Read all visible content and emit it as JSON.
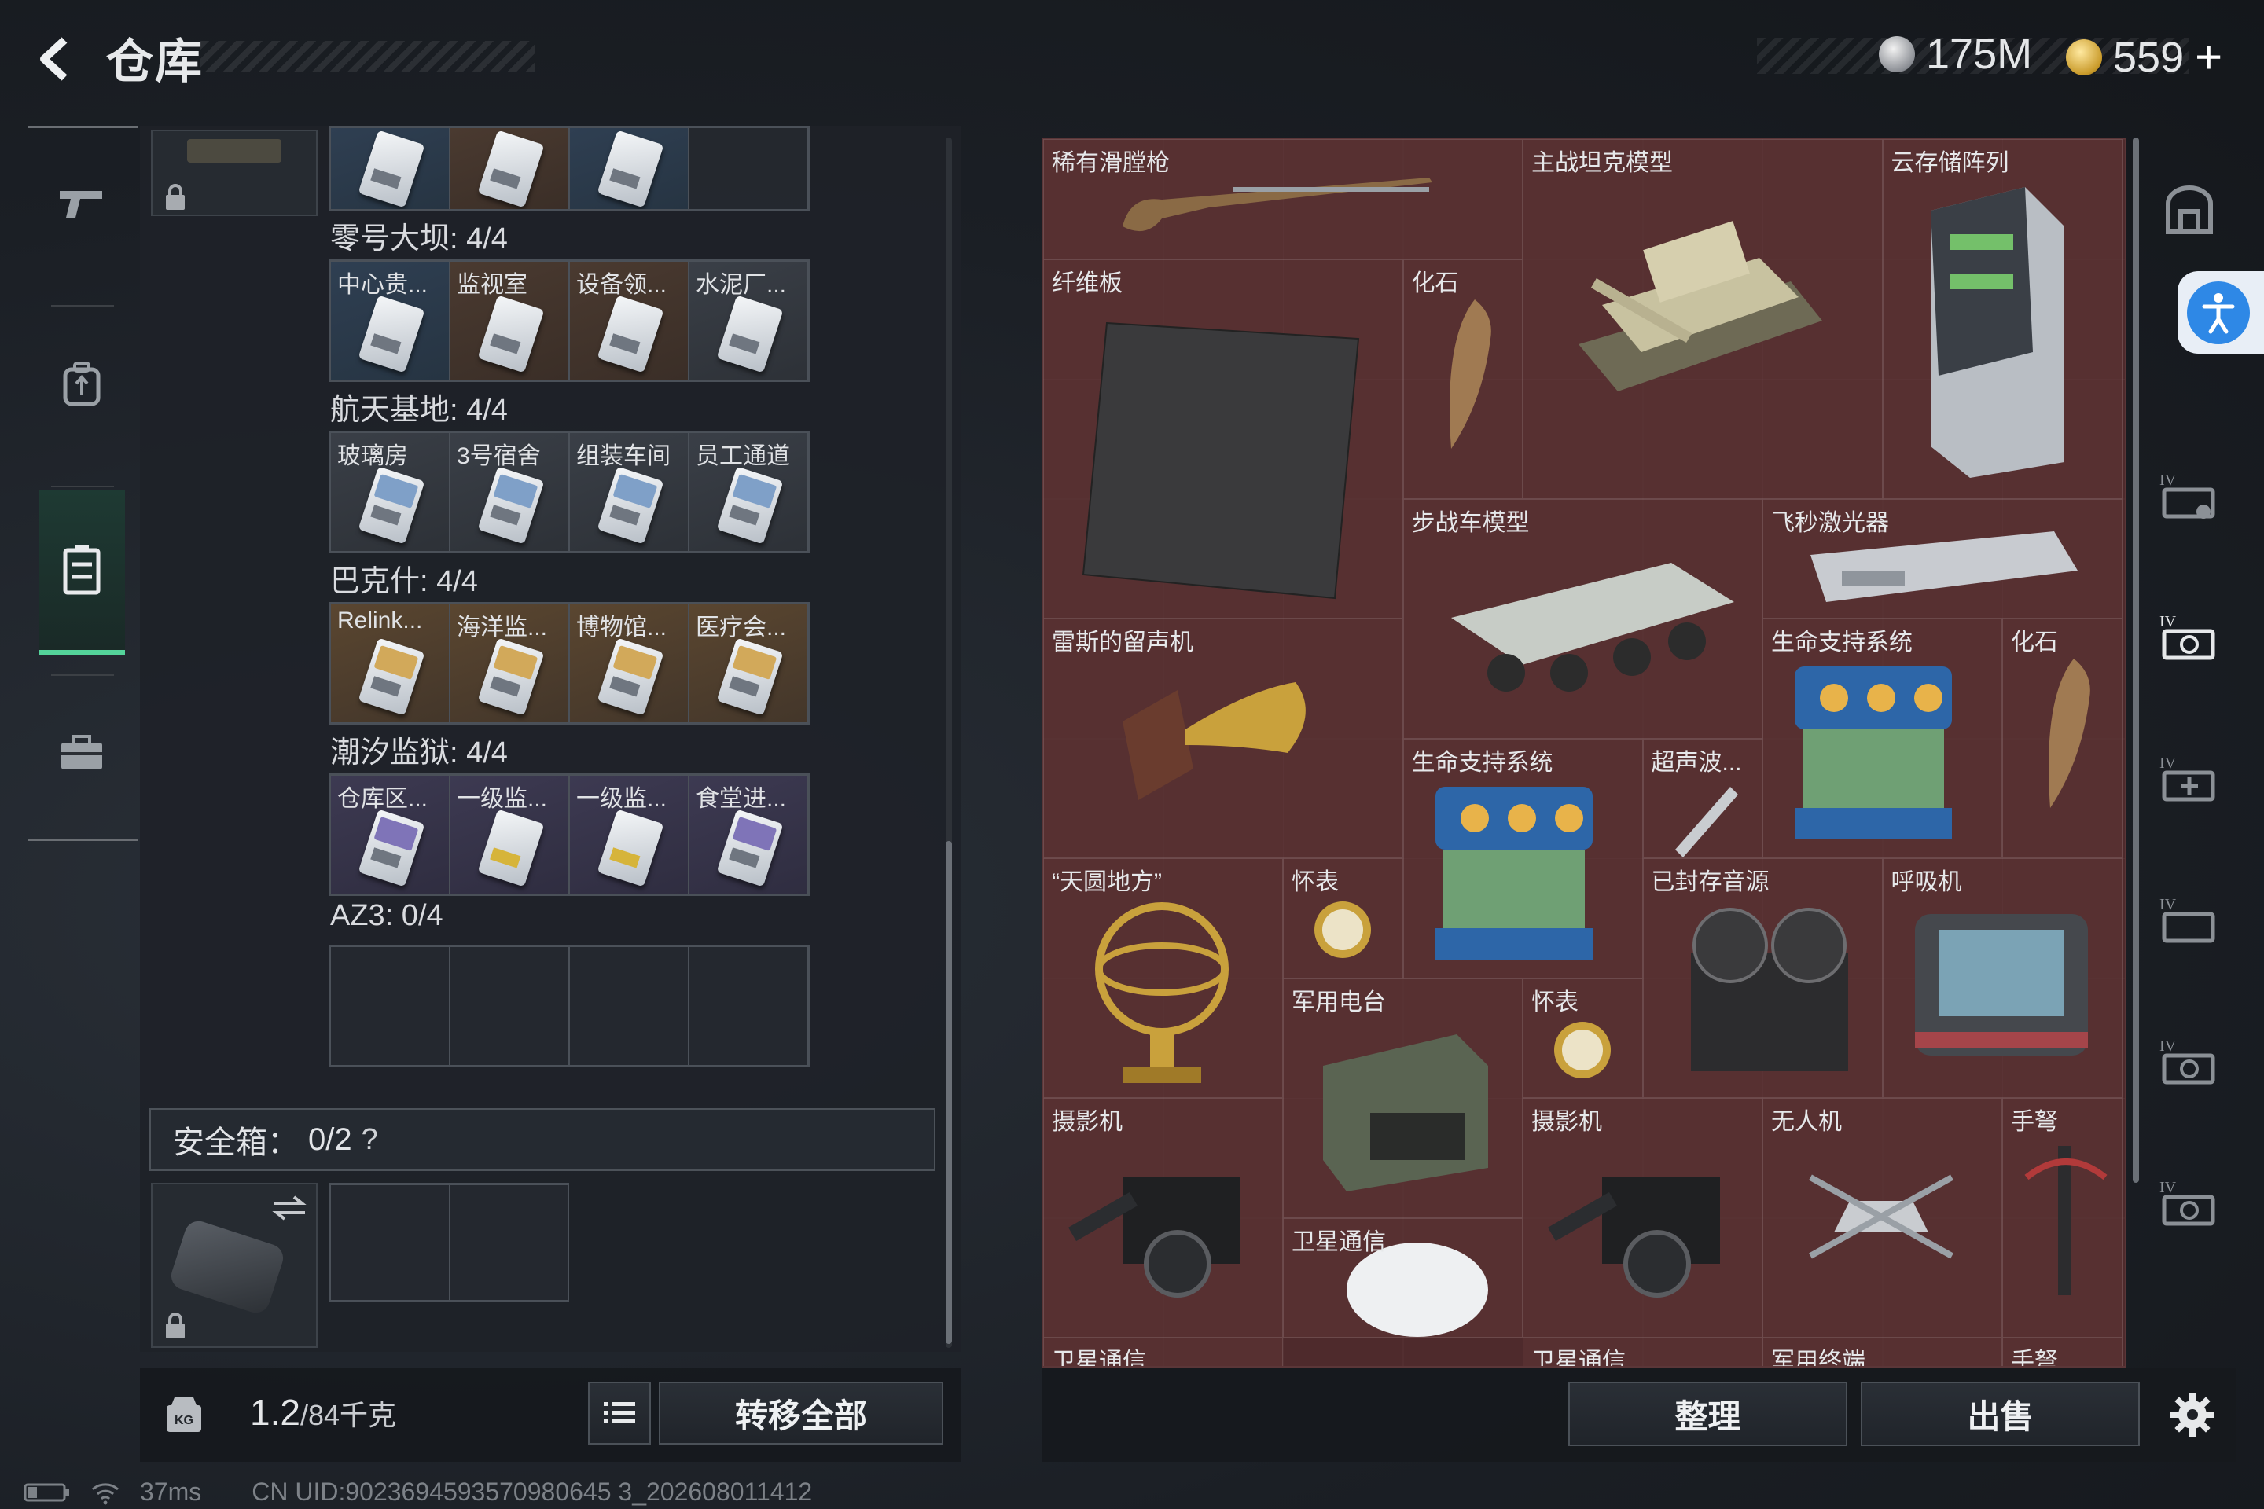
{
  "header": {
    "title": "仓库",
    "currency_silver": "175M",
    "currency_gold": "559"
  },
  "left_nav": {
    "items": [
      "gun-icon",
      "backpack-icon",
      "locker-icon",
      "briefcase-icon"
    ],
    "active_index": 2
  },
  "key_sections": [
    {
      "title": "零号大坝: 4/4",
      "cards": [
        {
          "label": "中心贵...",
          "tone": "blue"
        },
        {
          "label": "监视室",
          "tone": "brown"
        },
        {
          "label": "设备领...",
          "tone": "brown"
        },
        {
          "label": "水泥厂...",
          "tone": "gray"
        }
      ]
    },
    {
      "title": "航天基地: 4/4",
      "cards": [
        {
          "label": "玻璃房",
          "tone": "gray"
        },
        {
          "label": "3号宿舍",
          "tone": "gray"
        },
        {
          "label": "组装车间",
          "tone": "gray"
        },
        {
          "label": "员工通道",
          "tone": "gray"
        }
      ]
    },
    {
      "title": "巴克什: 4/4",
      "cards": [
        {
          "label": "Relink...",
          "tone": "gold"
        },
        {
          "label": "海洋监...",
          "tone": "gold"
        },
        {
          "label": "博物馆...",
          "tone": "gold"
        },
        {
          "label": "医疗会...",
          "tone": "gold"
        }
      ]
    },
    {
      "title": "潮汐监狱: 4/4",
      "cards": [
        {
          "label": "仓库区...",
          "tone": "purple"
        },
        {
          "label": "一级监...",
          "tone": "purple"
        },
        {
          "label": "一级监...",
          "tone": "purple"
        },
        {
          "label": "食堂进...",
          "tone": "purple"
        }
      ]
    },
    {
      "title": "AZ3: 0/4",
      "cards": []
    }
  ],
  "safebox": {
    "label": "安全箱：",
    "count": "0/2",
    "help": "?"
  },
  "bottom_left": {
    "weight_value": "1.2",
    "weight_total": "/84千克",
    "transfer_all": "转移全部"
  },
  "stash_items": [
    {
      "name": "稀有滑膛枪"
    },
    {
      "name": "主战坦克模型"
    },
    {
      "name": "云存储阵列"
    },
    {
      "name": "纤维板"
    },
    {
      "name": "化石"
    },
    {
      "name": "步战车模型"
    },
    {
      "name": "飞秒激光器"
    },
    {
      "name": "雷斯的留声机"
    },
    {
      "name": "生命支持系统"
    },
    {
      "name": "化石"
    },
    {
      "name": "生命支持系统"
    },
    {
      "name": "超声波..."
    },
    {
      "name": "“天圆地方”"
    },
    {
      "name": "怀表"
    },
    {
      "name": "已封存音源"
    },
    {
      "name": "呼吸机"
    },
    {
      "name": "军用电台"
    },
    {
      "name": "怀表"
    },
    {
      "name": "摄影机"
    },
    {
      "name": "摄影机"
    },
    {
      "name": "无人机"
    },
    {
      "name": "手弩"
    },
    {
      "name": "卫星通信"
    },
    {
      "name": "卫星通信"
    },
    {
      "name": "卫星通信"
    },
    {
      "name": "军用终端"
    },
    {
      "name": "手弩"
    }
  ],
  "bottom_right": {
    "sort_label": "整理",
    "sell_label": "出售"
  },
  "status_bar": {
    "ping": "37ms",
    "uid": "CN UID:9023694593570980645 3_202608011412"
  },
  "colors": {
    "accent_green": "#54d39a",
    "stash_bg": "#4e2a2c",
    "access_blue": "#2e88e6"
  }
}
